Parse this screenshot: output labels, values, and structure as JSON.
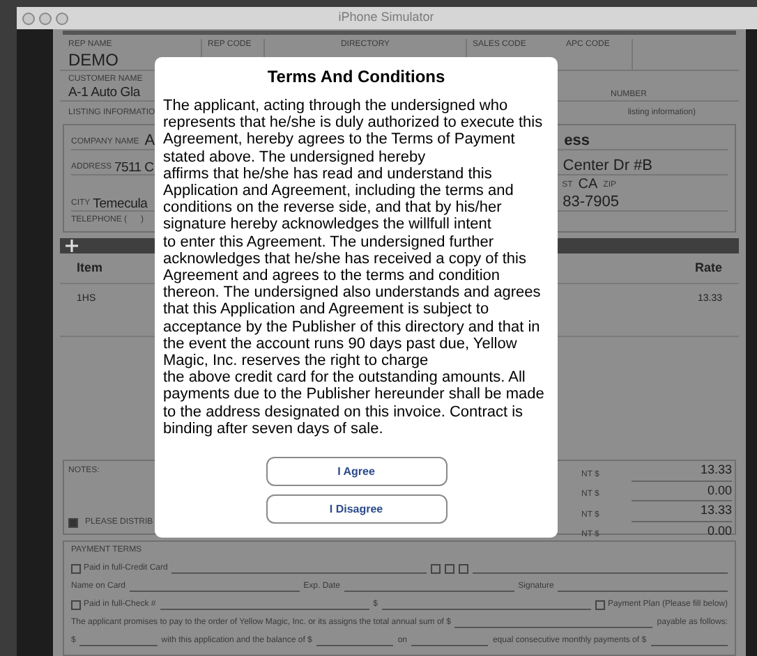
{
  "window": {
    "title": "iPhone Simulator"
  },
  "header": {
    "rep_name_label": "REP NAME",
    "rep_name": "DEMO",
    "rep_code_label": "REP CODE",
    "directory_label": "DIRECTORY",
    "sales_code_label": "SALES CODE",
    "apc_code_label": "APC CODE",
    "customer_name_label": "CUSTOMER NAME",
    "customer_name": "A-1 Auto Gla",
    "number_label": "NUMBER"
  },
  "listing": {
    "label": "LISTING INFORMATIO",
    "label_right": "listing information)",
    "company_label": "COMPANY NAME",
    "company_value": "A",
    "company_right": "ess",
    "address_label": "ADDRESS",
    "address_value": "7511 C",
    "address_right": "Center Dr #B",
    "state_label": "ST",
    "state_value": "CA",
    "zip_label": "ZIP",
    "city_label": "CITY",
    "city_value": "Temecula",
    "phone_right": "83-7905",
    "telephone_label": "TELEPHONE (",
    "telephone_close": ")"
  },
  "table": {
    "columns": [
      "Item",
      "Rate"
    ],
    "rows": [
      [
        "1HS",
        "13.33"
      ]
    ]
  },
  "notes": {
    "label": "NOTES:",
    "distribute_label": "PLEASE DISTRIB",
    "distribute_checked": true
  },
  "totals": [
    {
      "label": "NT $",
      "value": "13.33"
    },
    {
      "label": "NT $",
      "value": "0.00"
    },
    {
      "label": "NT $",
      "value": "13.33"
    },
    {
      "label": "NT $",
      "value": "0.00"
    }
  ],
  "payment_terms": {
    "label": "PAYMENT TERMS",
    "lines": [
      [
        {
          "kind": "check",
          "text": "Paid in full-Credit Card",
          "checked": false
        },
        {
          "kind": "blank"
        },
        {
          "kind": "check",
          "checked": false
        },
        {
          "kind": "check",
          "checked": false
        },
        {
          "kind": "check",
          "checked": false
        },
        {
          "kind": "blank"
        }
      ],
      [
        {
          "kind": "text",
          "text": "Name on Card"
        },
        {
          "kind": "blank"
        },
        {
          "kind": "text",
          "text": "Exp. Date"
        },
        {
          "kind": "blank"
        },
        {
          "kind": "text",
          "text": "Signature"
        },
        {
          "kind": "blank"
        }
      ],
      [
        {
          "kind": "check",
          "text": "Paid in full-Check #",
          "checked": false
        },
        {
          "kind": "blank"
        },
        {
          "kind": "text",
          "text": "$"
        },
        {
          "kind": "blank"
        },
        {
          "kind": "check",
          "text": "Payment Plan (Please fill below)",
          "checked": false
        }
      ],
      [
        {
          "kind": "text",
          "text": "The applicant promises to pay to the order of Yellow Magic, Inc. or its assigns the total annual sum of $"
        },
        {
          "kind": "blank"
        },
        {
          "kind": "text",
          "text": "payable as follows:"
        }
      ],
      [
        {
          "kind": "text",
          "text": "$"
        },
        {
          "kind": "blank"
        },
        {
          "kind": "text",
          "text": "with this application and the balance of $"
        },
        {
          "kind": "blank"
        },
        {
          "kind": "text",
          "text": "on"
        },
        {
          "kind": "blank"
        },
        {
          "kind": "text",
          "text": "equal consecutive monthly payments of $"
        },
        {
          "kind": "blank"
        }
      ]
    ]
  },
  "dialog": {
    "title": "Terms And Conditions",
    "body": "The applicant, acting through the undersigned who represents that he/she is duly authorized to execute this Agreement, hereby agrees to the Terms of Payment stated above. The undersigned hereby\naffirms that he/she has read and understand this Application and Agreement, including the terms and conditions on the reverse side, and that by his/her signature hereby acknowledges the willfull intent\nto enter this Agreement. The undersigned further acknowledges that he/she has received a copy of this Agreement and agrees to the terms and condition thereon. The undersigned also understands and agrees that this Application and Agreement is subject to acceptance by the Publisher of this directory and that in the event the account runs 90 days past due, Yellow Magic, Inc. reserves the right to charge\nthe above credit card for the outstanding amounts. All payments due to the Publisher hereunder shall be made to the address designated on this invoice. Contract is binding after seven days of sale.",
    "buttons": [
      "I Agree",
      "I Disagree"
    ]
  }
}
